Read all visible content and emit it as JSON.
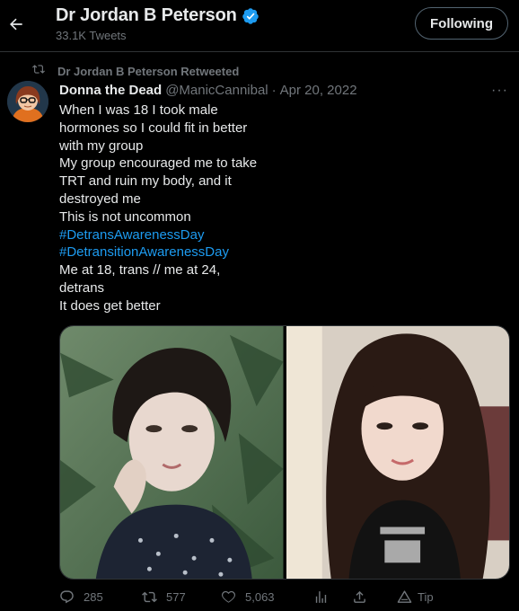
{
  "header": {
    "title": "Dr Jordan B Peterson",
    "subtitle": "33.1K Tweets",
    "follow_label": "Following"
  },
  "retweet_context": {
    "text": "Dr Jordan B Peterson Retweeted"
  },
  "tweet": {
    "author_name": "Donna the Dead",
    "handle": "@ManicCannibal",
    "separator": "·",
    "date": "Apr 20, 2022",
    "more_label": "···",
    "lines": [
      "When I was 18 I took male",
      "hormones so I could fit in better",
      "with my group",
      "My group encouraged me to take",
      "TRT and ruin my body, and it",
      "destroyed me",
      "This is not uncommon"
    ],
    "hashtags": [
      "#DetransAwarenessDay",
      "#DetransitionAwarenessDay"
    ],
    "lines_after": [
      "Me at 18, trans // me at 24,",
      "detrans",
      "It does get better"
    ]
  },
  "actions": {
    "replies": "285",
    "retweets": "577",
    "likes": "5,063",
    "tip_label": "Tip"
  },
  "colors": {
    "background": "#000000",
    "text": "#e7e9ea",
    "muted": "#71767b",
    "link": "#1d9bf0",
    "verified": "#1d9bf0"
  },
  "icons": [
    "back-arrow-icon",
    "verified-badge-icon",
    "retweet-icon",
    "more-icon",
    "reply-icon",
    "like-icon",
    "analytics-icon",
    "share-icon",
    "tip-icon"
  ]
}
